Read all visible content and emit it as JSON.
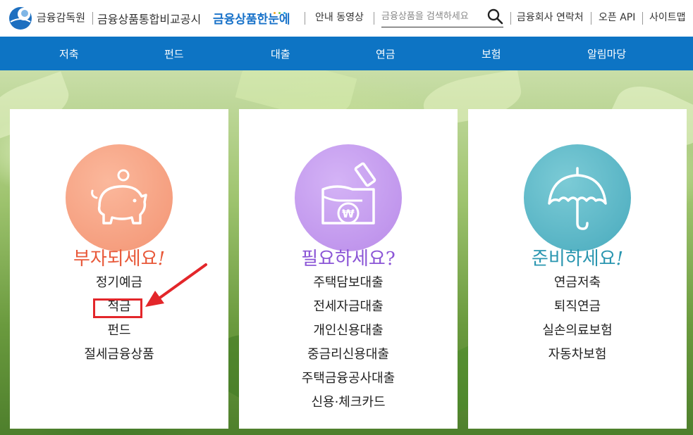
{
  "header": {
    "fss_name": "금융감독원",
    "site_name": "금융상품통합비교공시",
    "site_brand": "금융상품한눈에",
    "guide_video": "안내 동영상",
    "search_placeholder": "금융상품을 검색하세요",
    "contacts": "금융회사 연락처",
    "open_api": "오픈 API",
    "sitemap": "사이트맵"
  },
  "nav": {
    "items": [
      "저축",
      "펀드",
      "대출",
      "연금",
      "보험",
      "알림마당"
    ]
  },
  "cards": [
    {
      "title": "부자되세요",
      "punct": "!",
      "title_color": "#e8593a",
      "circle_color": "#f7a283",
      "icon": "piggy-bank-icon",
      "items": [
        "정기예금",
        "적금",
        "펀드",
        "절세금융상품"
      ]
    },
    {
      "title": "필요하세요",
      "punct": "?",
      "title_color": "#8b55d6",
      "circle_color": "#c49bf0",
      "icon": "won-wallet-icon",
      "items": [
        "주택담보대출",
        "전세자금대출",
        "개인신용대출",
        "중금리신용대출",
        "주택금융공사대출",
        "신용·체크카드"
      ]
    },
    {
      "title": "준비하세요",
      "punct": "!",
      "title_color": "#2a96b0",
      "circle_color": "#5cb6c4",
      "icon": "umbrella-icon",
      "items": [
        "연금저축",
        "퇴직연금",
        "실손의료보험",
        "자동차보험"
      ]
    }
  ],
  "colors": {
    "nav_bg": "#0d74c4",
    "brand_blue": "#1872c9",
    "highlight_red": "#e3262a"
  }
}
